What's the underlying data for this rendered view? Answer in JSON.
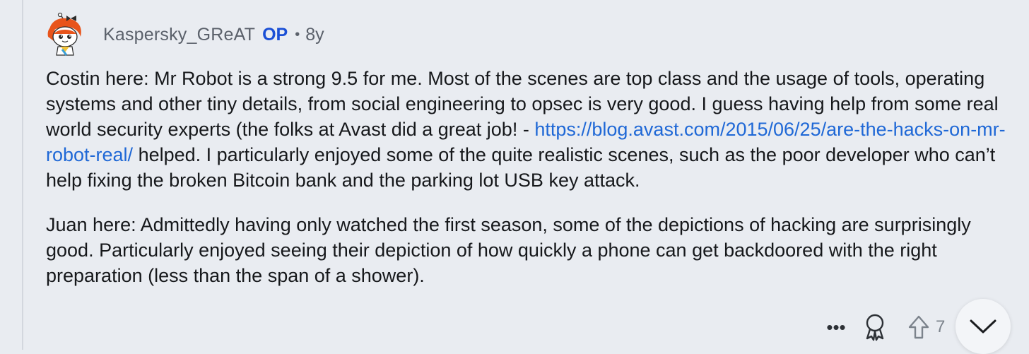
{
  "comment": {
    "author": "Kaspersky_GReAT",
    "op_badge": "OP",
    "separator": "•",
    "age": "8y",
    "avatar_icon": "snoo-avatar-icon",
    "paragraph1": {
      "text_before": "Costin here: Mr Robot is a strong 9.5 for me. Most of the scenes are top class and the usage of tools, operating systems and other tiny details, from social engineering to opsec is very good. I guess having help from some real world security experts (the folks at Avast did a great job! - ",
      "link_text": "https://blog.avast.com/2015/06/25/are-the-hacks-on-mr-robot-real/",
      "text_after": " helped. I particularly enjoyed some of the quite realistic scenes, such as the poor developer who can’t help fixing the broken Bitcoin bank and the parking lot USB key attack."
    },
    "paragraph2": "Juan here: Admittedly having only watched the first season, some of the depictions of hacking are surprisingly good. Particularly enjoyed seeing their depiction of how quickly a phone can get backdoored with the right preparation (less than the span of a shower).",
    "actions": {
      "more_glyph": "•••",
      "award_icon": "award-icon",
      "upvote_icon": "upvote-arrow-icon",
      "vote_count": "7",
      "collapse_icon": "chevron-down-icon"
    }
  },
  "colors": {
    "background": "#e9ecf1",
    "link": "#1f68d6",
    "op_badge": "#1a4fd6",
    "meta_text": "#5b616b"
  }
}
